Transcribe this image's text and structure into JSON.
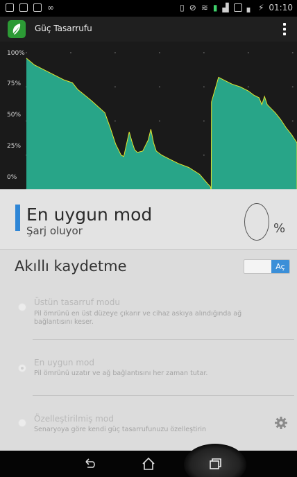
{
  "status_bar": {
    "left_icons": [
      "calendar-icon",
      "file-icon",
      "message-icon",
      "voicemail-icon"
    ],
    "right_icons": [
      "vibrate-icon",
      "no-signal-icon",
      "wifi-icon",
      "phone-icon",
      "signal-icon",
      "sim2-icon",
      "sim-signal-icon",
      "battery-charging-icon"
    ],
    "time": "01:10"
  },
  "action_bar": {
    "title": "Güç Tasarrufu",
    "app_icon": "leaf-icon",
    "menu_icon": "overflow-menu-icon"
  },
  "chart_data": {
    "type": "area",
    "y_tick_labels": [
      "100%",
      "75%",
      "50%",
      "25%",
      "0%"
    ],
    "ylim": [
      0,
      100
    ],
    "x_range": [
      0,
      100
    ],
    "grid": true,
    "area_color": "#28a588",
    "line_color": "#e3e42e",
    "series": [
      {
        "values": [
          [
            0,
            96
          ],
          [
            3,
            91
          ],
          [
            8,
            86
          ],
          [
            14,
            80
          ],
          [
            17,
            78
          ],
          [
            19,
            73
          ],
          [
            24,
            65
          ],
          [
            29,
            56
          ],
          [
            31,
            45
          ],
          [
            33,
            33
          ],
          [
            35,
            25
          ],
          [
            36,
            24
          ],
          [
            38,
            42
          ],
          [
            39,
            35
          ],
          [
            40,
            29
          ],
          [
            41,
            27
          ],
          [
            43,
            28
          ],
          [
            44,
            32
          ],
          [
            45,
            36
          ],
          [
            46,
            44
          ],
          [
            47,
            34
          ],
          [
            48,
            28
          ],
          [
            50,
            25
          ],
          [
            53,
            22
          ],
          [
            56,
            19
          ],
          [
            60,
            16
          ],
          [
            64,
            11
          ],
          [
            67,
            4
          ],
          [
            68,
            2
          ],
          [
            68.2,
            0
          ]
        ]
      },
      {
        "values": [
          [
            68.3,
            0
          ],
          [
            68.4,
            64
          ],
          [
            71,
            82
          ],
          [
            73,
            80
          ],
          [
            76,
            77
          ],
          [
            79,
            75
          ],
          [
            82,
            72
          ],
          [
            84,
            69
          ],
          [
            86,
            67
          ],
          [
            87,
            62
          ],
          [
            88,
            68
          ],
          [
            89,
            62
          ],
          [
            90,
            60
          ],
          [
            92,
            56
          ],
          [
            94,
            51
          ],
          [
            96,
            45
          ],
          [
            98,
            40
          ],
          [
            99,
            37
          ],
          [
            100,
            34
          ],
          [
            100,
            0
          ]
        ]
      }
    ]
  },
  "mode_card": {
    "title": "En uygun mod",
    "subtitle": "Şarj oluyor",
    "percent_value": "0",
    "percent_sign": "%",
    "accent": "#2f86d6"
  },
  "smart_save": {
    "title": "Akıllı kaydetme",
    "toggle_label": "Aç",
    "options": [
      {
        "title": "Üstün tasarruf modu",
        "desc": "Pil ömrünü en üst düzeye çıkarır ve cihaz askıya alındığında ağ bağlantısını keser.",
        "selected": false
      },
      {
        "title": "En uygun mod",
        "desc": "Pil ömrünü uzatır ve ağ bağlantısını her zaman tutar.",
        "selected": true
      },
      {
        "title": "Özelleştirilmiş mod",
        "desc": "Senaryoya göre kendi güç tasarrufunuzu özelleştirin",
        "selected": false,
        "action_icon": "settings-gear-icon"
      }
    ]
  },
  "nav_bar": {
    "items": [
      "back-icon",
      "home-icon",
      "recent-apps-icon"
    ]
  }
}
